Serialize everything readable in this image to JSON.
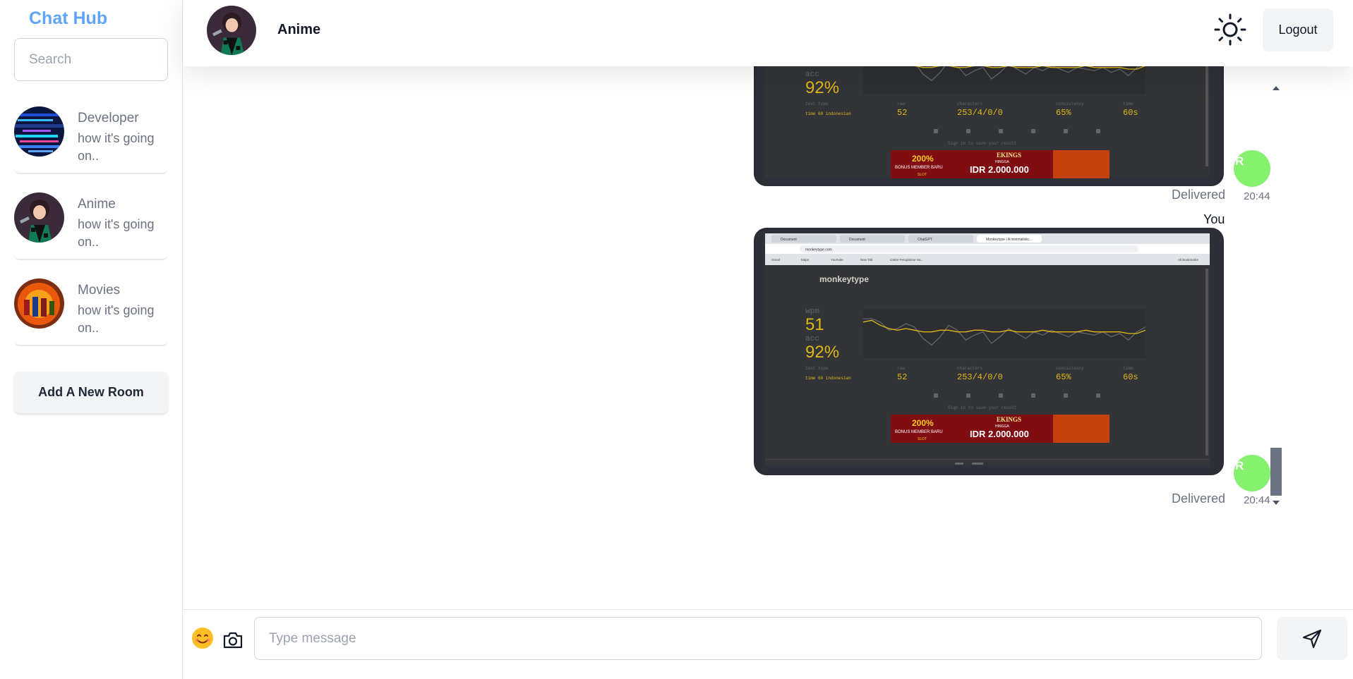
{
  "sidebar": {
    "brand": "Chat Hub",
    "search_placeholder": "Search",
    "rooms": [
      {
        "name": "Developer",
        "last_message": "how it's going on..",
        "avatar": "developer-room-avatar"
      },
      {
        "name": "Anime",
        "last_message": "how it's going on..",
        "avatar": "anime-room-avatar"
      },
      {
        "name": "Movies",
        "last_message": "how it's going on..",
        "avatar": "movies-room-avatar"
      }
    ],
    "add_room_label": "Add A New Room"
  },
  "header": {
    "room_title": "Anime",
    "theme_toggle_icon": "sun-icon",
    "logout_label": "Logout"
  },
  "messages": [
    {
      "type": "image",
      "image_content": "monkeytype-result-screenshot",
      "status": "Delivered",
      "time": "20:44",
      "avatar_initial": "R"
    },
    {
      "type": "image",
      "sender": "You",
      "image_content": "monkeytype-result-screenshot",
      "status": "Delivered",
      "time": "20:44",
      "avatar_initial": "R"
    }
  ],
  "screenshot_text": {
    "browser_tabs": [
      "Document",
      "Document",
      "ChatGPT",
      "Monkeytype | A minimalistic..."
    ],
    "url": "monkeytype.com",
    "bookmarks": [
      "Gmail",
      "Maps",
      "YouTube",
      "New Tab",
      "CSES Peruplanne Ha..."
    ],
    "all_bookmarks": "All Bookmarks",
    "site_name": "monkeytype",
    "wpm_label": "wpm",
    "wpm": "51",
    "acc_label": "acc",
    "acc": "92%",
    "test_type_label": "test type",
    "test_type_value": "time 60",
    "language": "indonesian",
    "raw_label": "raw",
    "raw": "52",
    "characters_label": "characters",
    "characters": "253/4/0/0",
    "consistency_label": "consistency",
    "consistency": "65%",
    "time_label": "time",
    "time_value": "60s",
    "sign_in_hint": "Sign in to save your result",
    "ad_headline": "200%",
    "ad_sub": "BONUS MEMBER BARU",
    "ad_brand": "EKINGS",
    "ad_amount_prefix": "HINGGA",
    "ad_amount": "IDR 2.000.000",
    "ad_tag": "SLOT",
    "wpm_series": [
      64,
      64,
      62,
      57,
      58,
      61,
      59,
      52,
      48,
      53,
      60,
      57,
      51,
      54,
      56,
      49,
      53,
      58,
      55,
      52,
      56,
      54,
      57,
      55,
      53,
      56,
      55,
      54,
      56,
      53,
      55,
      51,
      56,
      59
    ],
    "raw_series": [
      62,
      63,
      60,
      58,
      57,
      58,
      57,
      56,
      56,
      57,
      57,
      56,
      56,
      57,
      57,
      56,
      56,
      57,
      56,
      56,
      56,
      57,
      56,
      56,
      56,
      56,
      57,
      56,
      56,
      56,
      56,
      55,
      55,
      57
    ]
  },
  "composer": {
    "emoji_icon": "smiley-emoji-icon",
    "camera_icon": "camera-icon",
    "placeholder": "Type message",
    "send_icon": "send-icon"
  }
}
